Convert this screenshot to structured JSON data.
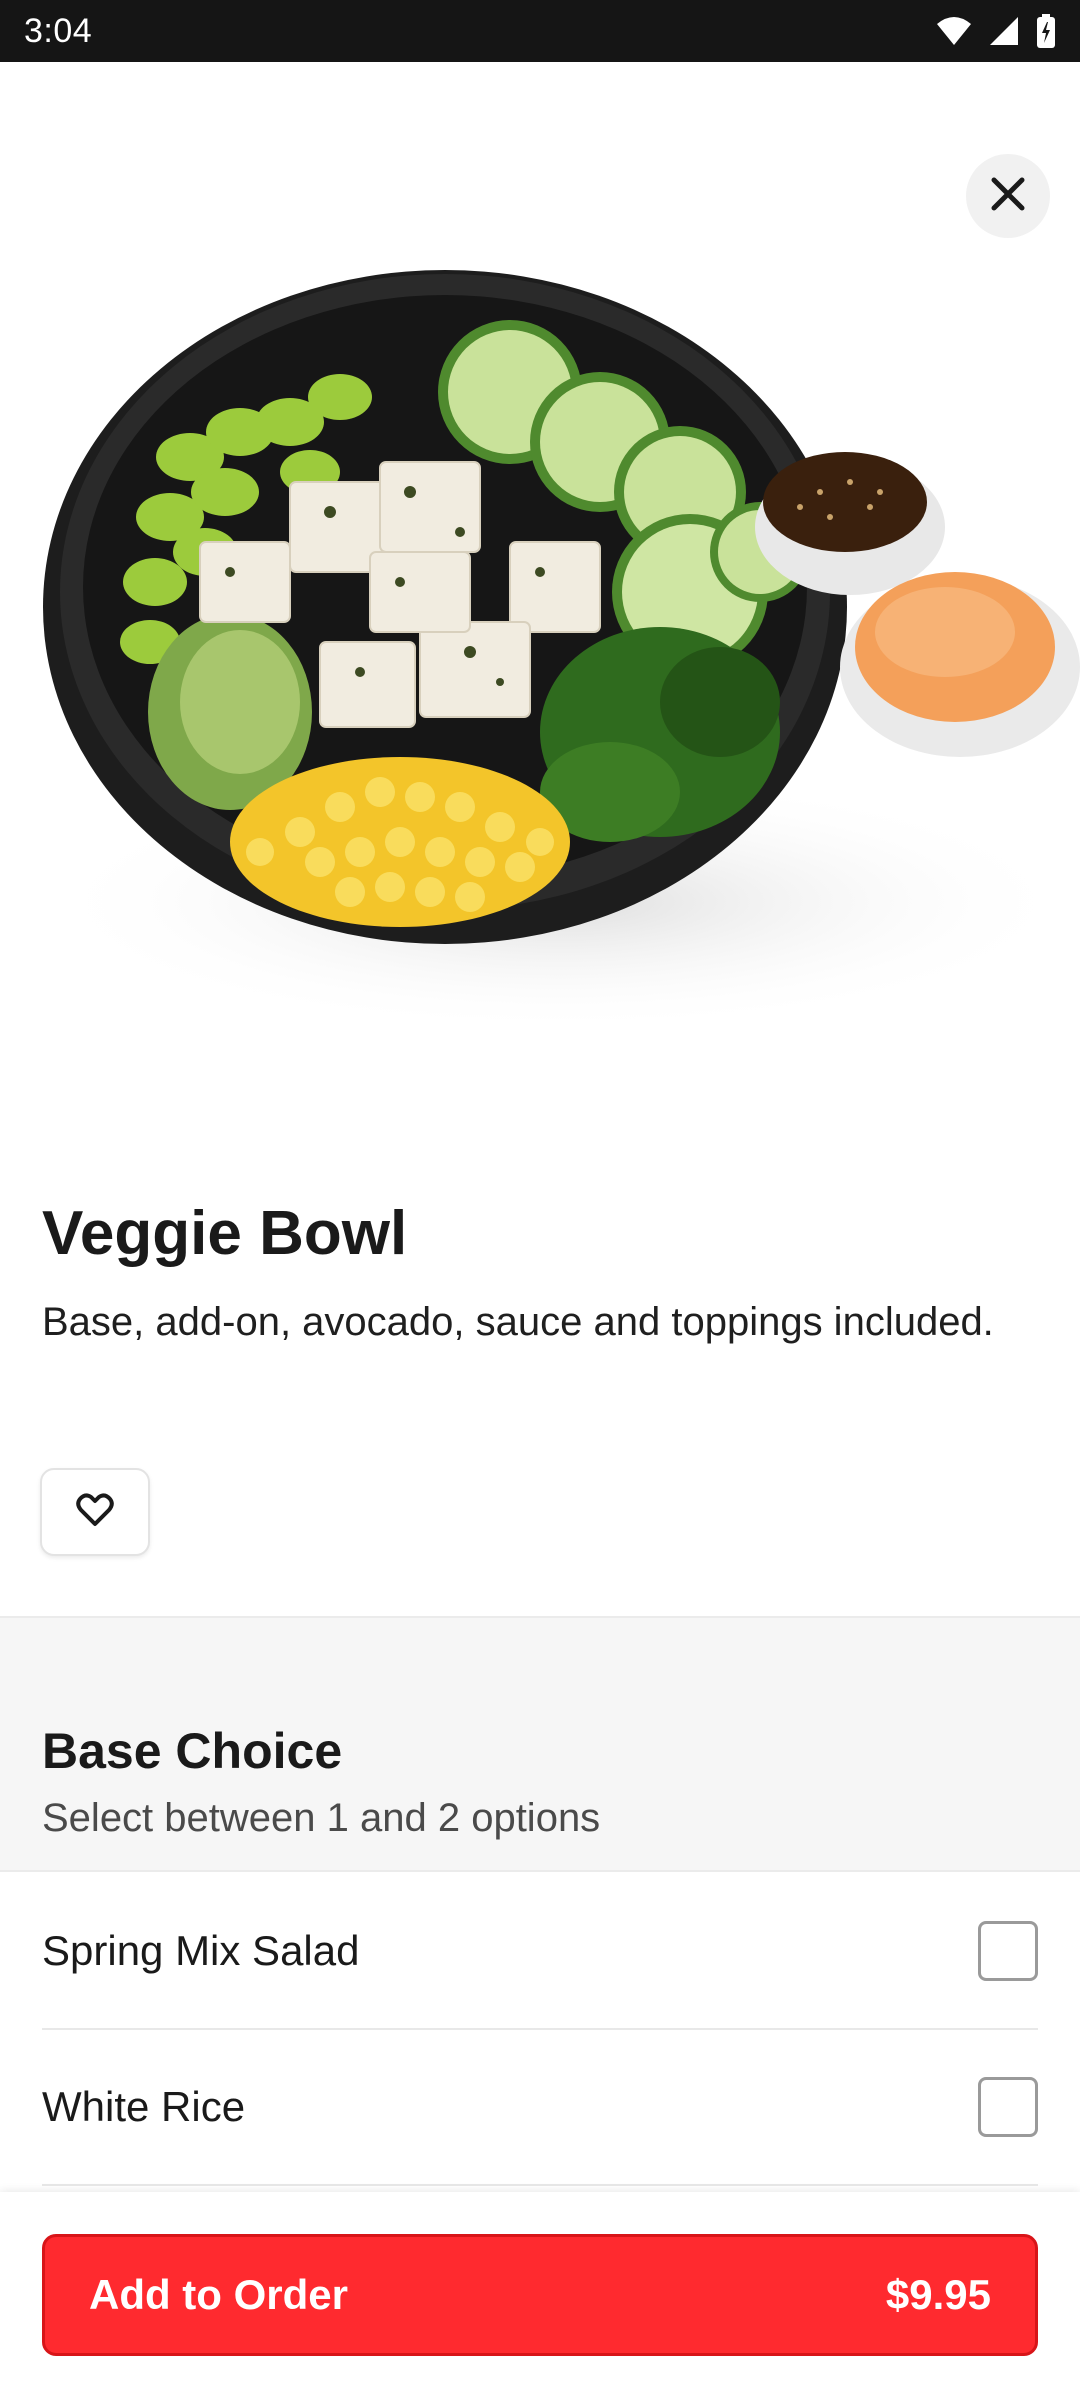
{
  "status_bar": {
    "time": "3:04"
  },
  "item": {
    "title": "Veggie Bowl",
    "description": "Base, add-on, avocado, sauce and toppings included."
  },
  "section": {
    "title": "Base Choice",
    "subtitle": "Select between 1 and 2 options",
    "options": [
      {
        "label": "Spring Mix Salad",
        "checked": false
      },
      {
        "label": "White Rice",
        "checked": false
      }
    ]
  },
  "footer": {
    "add_label": "Add to Order",
    "price": "$9.95"
  },
  "colors": {
    "accent": "#ff2a2f",
    "status_bar": "#151515"
  },
  "icons": [
    "wifi-icon",
    "signal-icon",
    "battery-icon",
    "close-icon",
    "heart-icon"
  ]
}
